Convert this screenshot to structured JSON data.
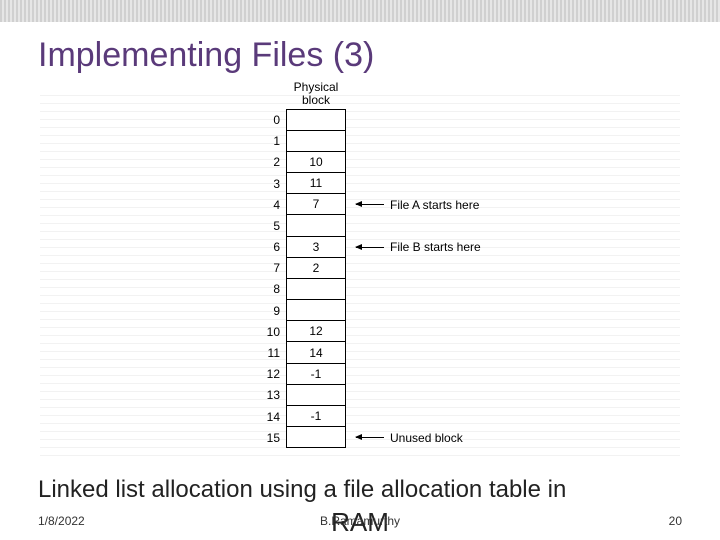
{
  "slide": {
    "title": "Implementing Files (3)",
    "caption": "Linked list allocation using a file allocation table in",
    "caption2": "RAM",
    "footer": {
      "date": "1/8/2022",
      "author": "B.Ramamurthy",
      "page": "20"
    }
  },
  "diagram": {
    "header": "Physical block",
    "rows": [
      {
        "idx": "0",
        "val": "",
        "ann": ""
      },
      {
        "idx": "1",
        "val": "",
        "ann": ""
      },
      {
        "idx": "2",
        "val": "10",
        "ann": ""
      },
      {
        "idx": "3",
        "val": "11",
        "ann": ""
      },
      {
        "idx": "4",
        "val": "7",
        "ann": "File A starts here"
      },
      {
        "idx": "5",
        "val": "",
        "ann": ""
      },
      {
        "idx": "6",
        "val": "3",
        "ann": "File B starts here"
      },
      {
        "idx": "7",
        "val": "2",
        "ann": ""
      },
      {
        "idx": "8",
        "val": "",
        "ann": ""
      },
      {
        "idx": "9",
        "val": "",
        "ann": ""
      },
      {
        "idx": "10",
        "val": "12",
        "ann": ""
      },
      {
        "idx": "11",
        "val": "14",
        "ann": ""
      },
      {
        "idx": "12",
        "val": "-1",
        "ann": ""
      },
      {
        "idx": "13",
        "val": "",
        "ann": ""
      },
      {
        "idx": "14",
        "val": "-1",
        "ann": ""
      },
      {
        "idx": "15",
        "val": "",
        "ann": "Unused block"
      }
    ]
  }
}
